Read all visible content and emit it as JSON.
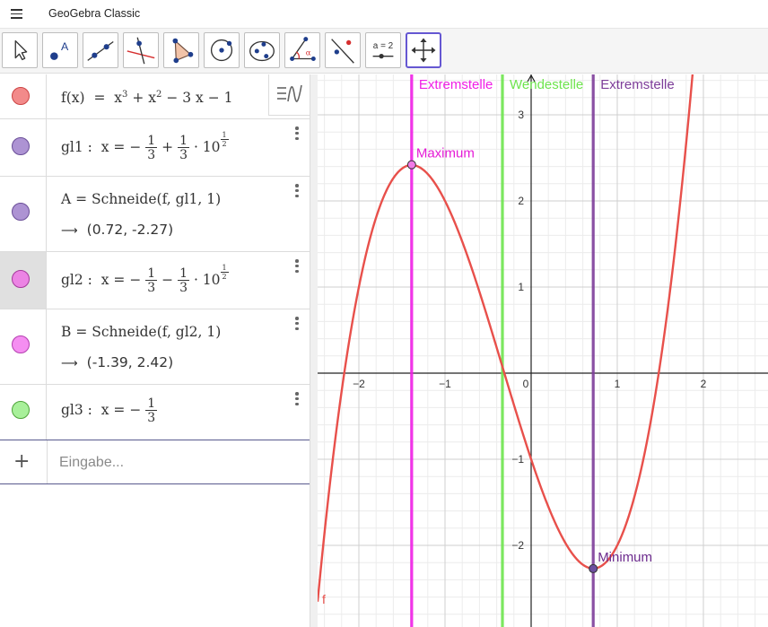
{
  "app": {
    "title": "GeoGebra Classic"
  },
  "toolbar": {
    "tools": [
      {
        "name": "move-tool-button",
        "icon": "arrow-pointer-icon"
      },
      {
        "name": "point-tool-button",
        "icon": "point-icon"
      },
      {
        "name": "line-tool-button",
        "icon": "line-icon"
      },
      {
        "name": "perpendicular-line-tool-button",
        "icon": "perpendicular-line-icon"
      },
      {
        "name": "polygon-tool-button",
        "icon": "polygon-icon"
      },
      {
        "name": "circle-tool-button",
        "icon": "circle-center-point-icon"
      },
      {
        "name": "ellipse-tool-button",
        "icon": "ellipse-icon"
      },
      {
        "name": "angle-tool-button",
        "icon": "angle-icon"
      },
      {
        "name": "reflect-tool-button",
        "icon": "reflect-about-line-icon"
      },
      {
        "name": "slider-tool-button",
        "icon": "slider-icon",
        "label": "a = 2"
      },
      {
        "name": "move-graphics-view-button",
        "icon": "move-arrows-icon",
        "selected": true
      }
    ]
  },
  "algebra": {
    "rows": [
      {
        "id": "f",
        "color": "#f16a6a",
        "name": "f(x)",
        "eq": "=",
        "expr_main": "x",
        "expr_tail": "3 − 1"
      },
      {
        "id": "gl1",
        "color": "#9c7fc8",
        "name": "gl1",
        "prefix": "x = −",
        "frac1_num": "1",
        "frac1_den": "3",
        "op": "+",
        "frac2_num": "1",
        "frac2_den": "3",
        "tail": "· 10",
        "exp_num": "1",
        "exp_den": "2"
      },
      {
        "id": "A",
        "color": "#9c7fc8",
        "definition": "A = Schneide(f, gl1, 1)",
        "value": "(0.72, -2.27)"
      },
      {
        "id": "gl2",
        "color": "#e579e0",
        "name": "gl2",
        "prefix": "x = −",
        "frac1_num": "1",
        "frac1_den": "3",
        "op": "−",
        "frac2_num": "1",
        "frac2_den": "3",
        "tail": "· 10",
        "exp_num": "1",
        "exp_den": "2"
      },
      {
        "id": "B",
        "color": "#f489f0",
        "definition": "B = Schneide(f, gl2, 1)",
        "value": "(-1.39, 2.42)"
      },
      {
        "id": "gl3",
        "color": "#9ef08e",
        "name": "gl3",
        "prefix": "x = −",
        "frac1_num": "1",
        "frac1_den": "3"
      }
    ],
    "input_placeholder": "Eingabe..."
  },
  "graphics": {
    "x_ticks": [
      "−2",
      "−1",
      "0",
      "1",
      "2"
    ],
    "y_ticks": [
      "3",
      "2",
      "1",
      "−1",
      "−2"
    ],
    "curve_label": "f",
    "curve_color": "#e8504b",
    "lines": [
      {
        "label": "Extremstelle",
        "x": -1.387,
        "color": "#f01ee6"
      },
      {
        "label": "Wendestelle",
        "x": -0.3333,
        "color": "#6ee44e"
      },
      {
        "label": "Extremstelle",
        "x": 0.7208,
        "color": "#7d3d99"
      }
    ],
    "points": [
      {
        "label": "Maximum",
        "x": -1.387,
        "y": 2.42,
        "fill": "#f27ae8",
        "label_color": "#e51ad6"
      },
      {
        "label": "Minimum",
        "x": 0.7208,
        "y": -2.27,
        "fill": "#6d4fa0",
        "label_color": "#6d2c8e"
      }
    ]
  }
}
